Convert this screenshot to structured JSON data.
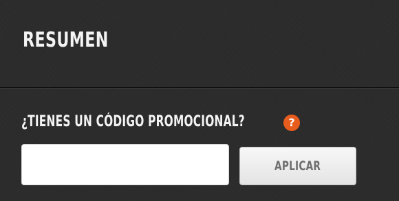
{
  "summary": {
    "title": "RESUMEN"
  },
  "promo": {
    "question": "¿TIENES UN CÓDIGO PROMOCIONAL?",
    "help_icon": "question-mark-icon",
    "help_glyph": "?",
    "input_value": "",
    "input_placeholder": "",
    "apply_label": "APLICAR"
  },
  "colors": {
    "background": "#2c2c2c",
    "heading_text": "#f4f4f4",
    "help_icon_bg": "#e85d1e",
    "button_text": "#6f6f6f"
  }
}
